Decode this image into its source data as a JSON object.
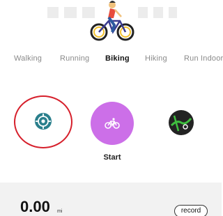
{
  "tabs": [
    {
      "label": "Walking"
    },
    {
      "label": "Running"
    },
    {
      "label": "Biking"
    },
    {
      "label": "Hiking"
    },
    {
      "label": "Run Indoor"
    }
  ],
  "active_tab": "Biking",
  "controls": {
    "location_icon": "location-target-icon",
    "start_label": "Start",
    "start_icon": "bicycle-icon",
    "map_icon": "map-icon"
  },
  "stats": {
    "distance_value": "0.00",
    "distance_unit": "mi",
    "record_label": "record"
  },
  "colors": {
    "start_button": "#cc6fe8",
    "location_icon": "#2a7f8c",
    "highlight_ring": "#d61f2b",
    "map_button": "#232323"
  }
}
